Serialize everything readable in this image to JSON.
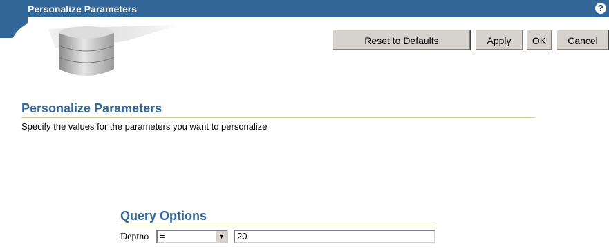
{
  "header": {
    "title": "Personalize Parameters",
    "help_icon": "question-mark-icon",
    "accent_color": "#336699"
  },
  "toolbar": {
    "reset_label": "Reset to Defaults",
    "apply_label": "Apply",
    "ok_label": "OK",
    "cancel_label": "Cancel"
  },
  "main": {
    "title": "Personalize Parameters",
    "instructions": "Specify the values for the parameters you want to personalize"
  },
  "query_options": {
    "title": "Query Options",
    "field_label": "Deptno",
    "operator_value": "=",
    "value": "20"
  }
}
